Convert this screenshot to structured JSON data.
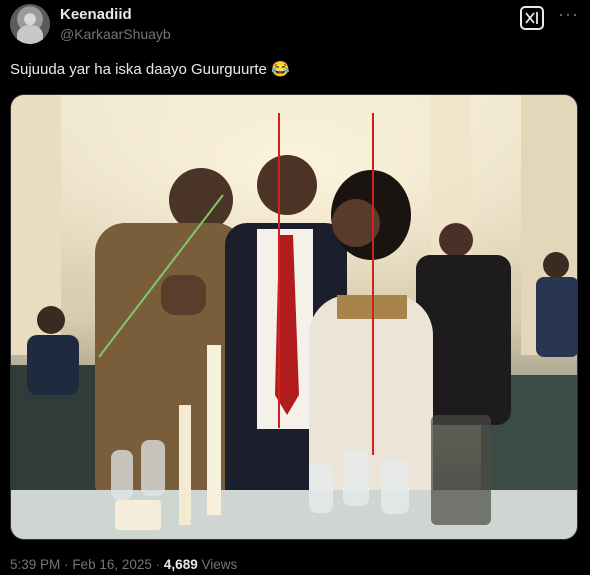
{
  "author": {
    "display_name": "Keenadiid",
    "handle": "@KarkaarShuayb"
  },
  "post": {
    "text": "Sujuuda yar ha iska daayo Guurguurte 😂"
  },
  "header_icons": {
    "app_icon": "xai-logo-icon",
    "more": "···"
  },
  "meta": {
    "time": "5:39 PM",
    "separator": "·",
    "date": "Feb 16, 2025",
    "views_count": "4,689",
    "views_label": "Views"
  }
}
